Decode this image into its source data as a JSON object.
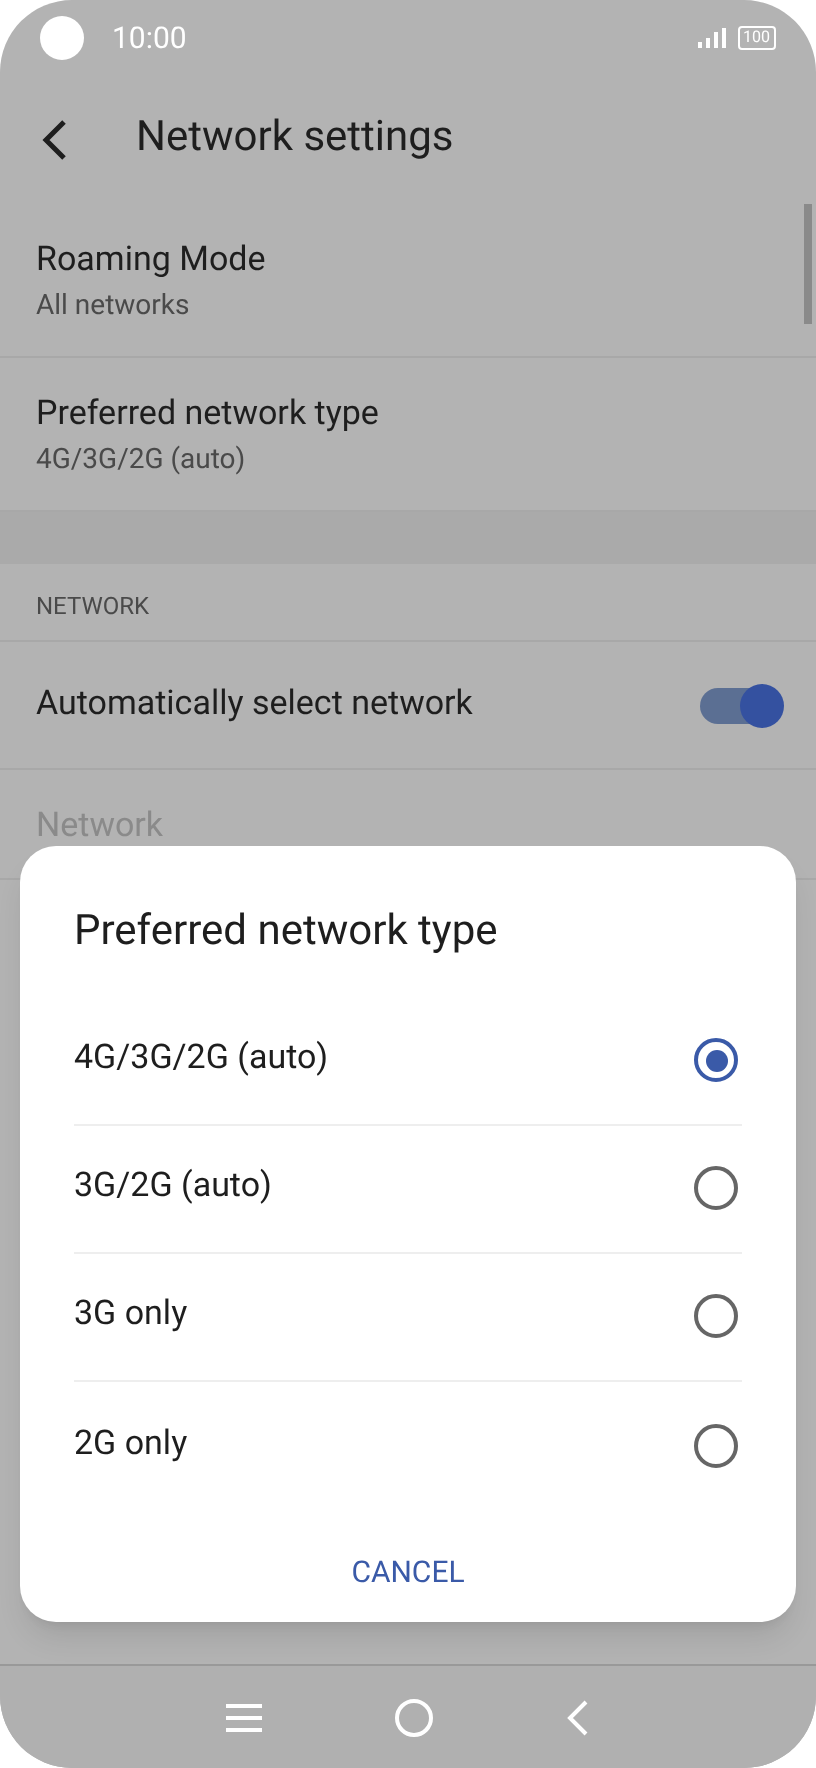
{
  "status_bar": {
    "time": "10:00",
    "battery": "100"
  },
  "header": {
    "title": "Network settings"
  },
  "settings": [
    {
      "kind": "item",
      "title": "Roaming Mode",
      "subtitle": "All networks"
    },
    {
      "kind": "item",
      "title": "Preferred network type",
      "subtitle": "4G/3G/2G (auto)"
    },
    {
      "kind": "section",
      "title": "NETWORK"
    },
    {
      "kind": "toggle",
      "title": "Automatically select network",
      "on": true
    },
    {
      "kind": "item",
      "title": "Network",
      "disabled": true
    }
  ],
  "dialog": {
    "title": "Preferred network type",
    "options": [
      {
        "label": "4G/3G/2G (auto)",
        "selected": true
      },
      {
        "label": "3G/2G (auto)",
        "selected": false
      },
      {
        "label": "3G only",
        "selected": false
      },
      {
        "label": "2G only",
        "selected": false
      }
    ],
    "cancel": "CANCEL"
  }
}
